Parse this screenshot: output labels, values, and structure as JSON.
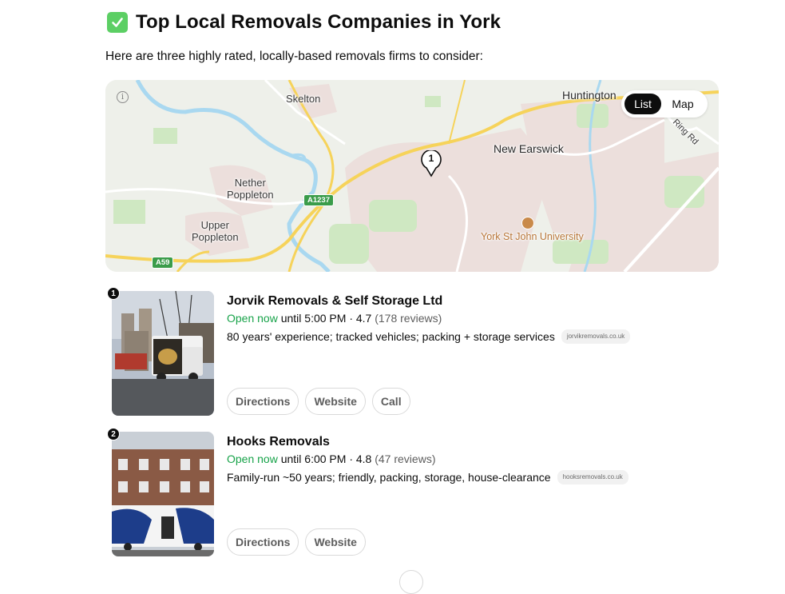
{
  "heading": {
    "icon": "white-check-mark-icon",
    "title": "Top Local Removals Companies in York"
  },
  "intro": "Here are three highly rated, locally-based removals firms to consider:",
  "map": {
    "toggle": {
      "list_label": "List",
      "map_label": "Map",
      "selected": "List"
    },
    "labels": {
      "skelton": "Skelton",
      "huntington": "Huntington",
      "new_earswick": "New Earswick",
      "nether_poppleton": "Nether\nPoppleton",
      "upper_poppleton": "Upper\nPoppleton",
      "york_st_john": "York St John University",
      "ring_rd": "Ring Rd"
    },
    "roads": {
      "a1237": "A1237",
      "a59": "A59"
    },
    "pin_number": "1",
    "colors": {
      "land": "#eef0ea",
      "park": "#cfe8c2",
      "water": "#a9d8f0",
      "major_road": "#f6d35a",
      "urban": "#ecdfdc"
    }
  },
  "listings": [
    {
      "number": "1",
      "name": "Jorvik Removals & Self Storage Ltd",
      "status": "Open now",
      "hours": " until 5:00 PM · 4.7 ",
      "reviews": "(178 reviews)",
      "description": "80 years' experience; tracked vehicles; packing + storage services",
      "source": "jorvikremovals.co.uk",
      "actions": [
        "Directions",
        "Website",
        "Call"
      ]
    },
    {
      "number": "2",
      "name": "Hooks Removals",
      "status": "Open now",
      "hours": " until 6:00 PM · 4.8 ",
      "reviews": "(47 reviews)",
      "description": "Family-run ~50 years; friendly, packing, storage, house-clearance",
      "source": "hooksremovals.co.uk",
      "actions": [
        "Directions",
        "Website"
      ]
    }
  ]
}
